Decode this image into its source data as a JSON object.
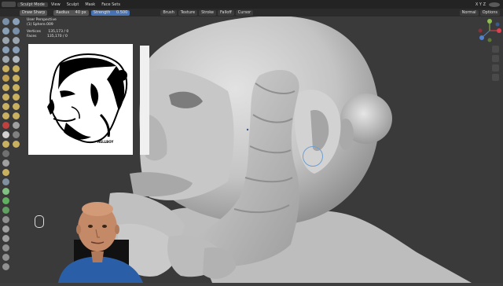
{
  "topbar": {
    "mode": "Sculpt Mode",
    "menus": [
      "View",
      "Sculpt",
      "Mask",
      "Face Sets"
    ]
  },
  "toolheader": {
    "tool_name": "Draw Sharp",
    "radius_label": "Radius",
    "radius_value": "40 px",
    "strength_label": "Strength",
    "strength_value": "0.500",
    "dropdowns": [
      "Brush",
      "Texture",
      "Stroke",
      "Falloff",
      "Cursor"
    ],
    "symmetry": "X Y Z",
    "orientation": "Normal",
    "options": "Options"
  },
  "overlay": {
    "view": "User Perspective",
    "object": "(1) Sphere.009",
    "vertices_label": "Vertices",
    "vertices_value": "135,173 / 0",
    "faces_label": "Faces",
    "faces_value": "135,170 / 0"
  },
  "reference": {
    "signature": "HELLBOY"
  },
  "colors": {
    "accent": "#4772b3",
    "header": "#232323",
    "viewport_bg": "#3a3a3a",
    "sculpt": "#cfcfcf"
  }
}
